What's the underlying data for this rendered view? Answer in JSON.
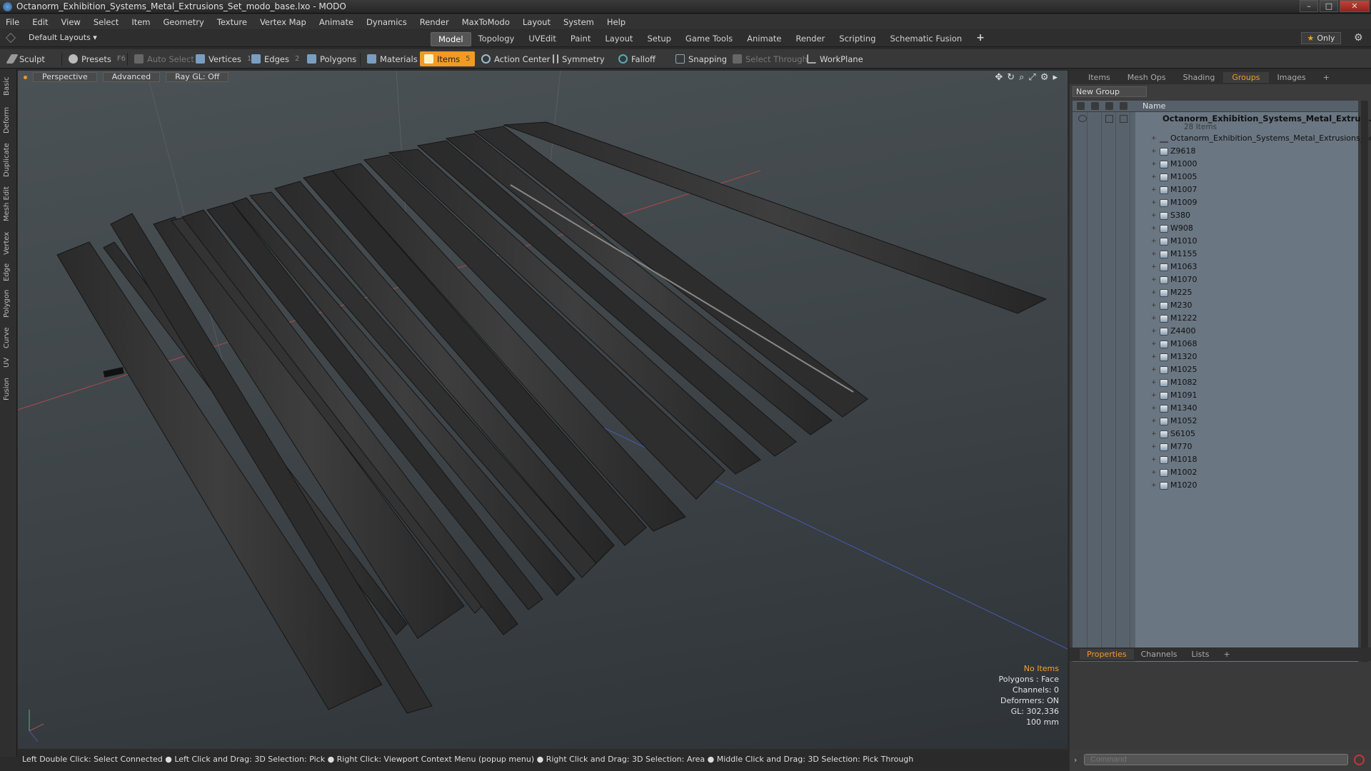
{
  "window": {
    "title": "Octanorm_Exhibition_Systems_Metal_Extrusions_Set_modo_base.lxo - MODO",
    "controls": [
      "–",
      "□",
      "✕"
    ]
  },
  "menu": [
    "File",
    "Edit",
    "View",
    "Select",
    "Item",
    "Geometry",
    "Texture",
    "Vertex Map",
    "Animate",
    "Dynamics",
    "Render",
    "MaxToModo",
    "Layout",
    "System",
    "Help"
  ],
  "layout": {
    "dropdown": "Default Layouts ▾",
    "tabs": [
      "Model",
      "Topology",
      "UVEdit",
      "Paint",
      "Layout",
      "Setup",
      "Game Tools",
      "Animate",
      "Render",
      "Scripting",
      "Schematic Fusion",
      "+"
    ],
    "active_tab": "Model",
    "only_label": "Only"
  },
  "toolbar": {
    "sculpt": "Sculpt",
    "presets": "Presets",
    "presets_key": "F6",
    "auto_select": "Auto Select",
    "vertices": "Vertices",
    "vertices_count": "1",
    "edges": "Edges",
    "edges_count": "2",
    "polygons": "Polygons",
    "materials": "Materials",
    "items": "Items",
    "items_count": "5",
    "action_center": "Action Center",
    "symmetry": "Symmetry",
    "falloff": "Falloff",
    "snapping": "Snapping",
    "select_through": "Select Through",
    "workplane": "WorkPlane"
  },
  "left_tabs": [
    "Basic",
    "Deform",
    "Duplicate",
    "Mesh Edit",
    "Vertex",
    "Edge",
    "Polygon",
    "Curve",
    "UV",
    "Fusion"
  ],
  "viewport": {
    "view": "Perspective",
    "shading": "Advanced",
    "raygl": "Ray GL: Off",
    "info": {
      "items": "No Items",
      "polygons": "Polygons : Face",
      "channels": "Channels: 0",
      "deformers": "Deformers: ON",
      "gl": "GL: 302,336",
      "unit": "100 mm"
    }
  },
  "status_bar": "Left Double Click: Select Connected ● Left Click and Drag: 3D Selection: Pick ● Right Click: Viewport Context Menu (popup menu) ● Right Click and Drag: 3D Selection: Area ● Middle Click and Drag: 3D Selection: Pick Through",
  "right_panel": {
    "tabs": [
      "Items",
      "Mesh Ops",
      "Shading",
      "Groups",
      "Images",
      "+"
    ],
    "active_tab": "Groups",
    "new_group": "New Group",
    "column_name": "Name",
    "root": "Octanorm_Exhibition_Systems_Metal_Extrusi...",
    "root_count": "28 Items",
    "group_item": "Octanorm_Exhibition_Systems_Metal_Extrusions_Set",
    "items": [
      "Z9618",
      "M1000",
      "M1005",
      "M1007",
      "M1009",
      "S380",
      "W908",
      "M1010",
      "M1155",
      "M1063",
      "M1070",
      "M225",
      "M230",
      "M1222",
      "Z4400",
      "M1068",
      "M1320",
      "M1025",
      "M1082",
      "M1091",
      "M1340",
      "M1052",
      "S6105",
      "M770",
      "M1018",
      "M1002",
      "M1020"
    ]
  },
  "props": {
    "tabs": [
      "Properties",
      "Channels",
      "Lists",
      "+"
    ],
    "active_tab": "Properties"
  },
  "command": {
    "placeholder": "Command"
  }
}
